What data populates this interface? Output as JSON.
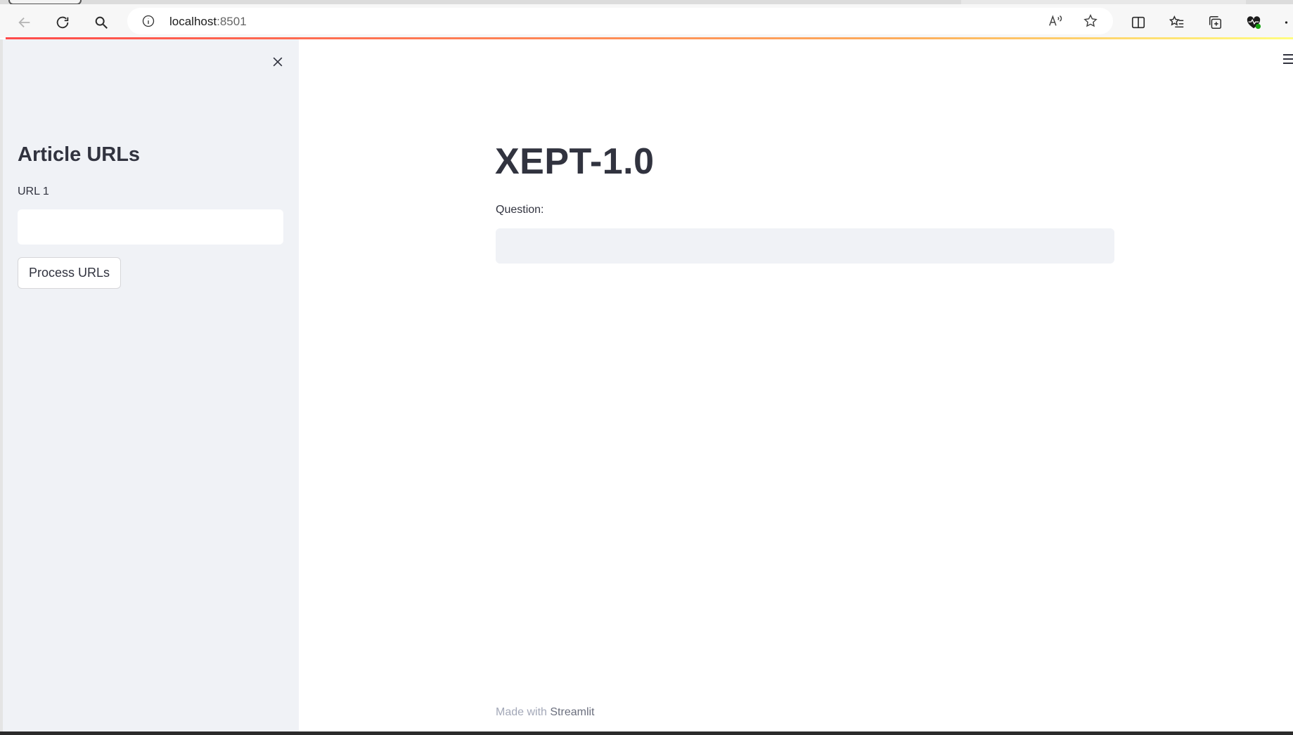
{
  "browser": {
    "address": {
      "host": "localhost",
      "port": ":8501"
    }
  },
  "sidebar": {
    "title": "Article URLs",
    "url_label": "URL 1",
    "url_value": "",
    "button_label": "Process URLs"
  },
  "main": {
    "title": "XEPT-1.0",
    "question_label": "Question:",
    "question_value": ""
  },
  "footer": {
    "prefix": "Made with ",
    "brand": "Streamlit"
  },
  "colors": {
    "accent": "#ff4b4b",
    "sidebar_bg": "#f0f2f6",
    "text": "#31333f"
  }
}
